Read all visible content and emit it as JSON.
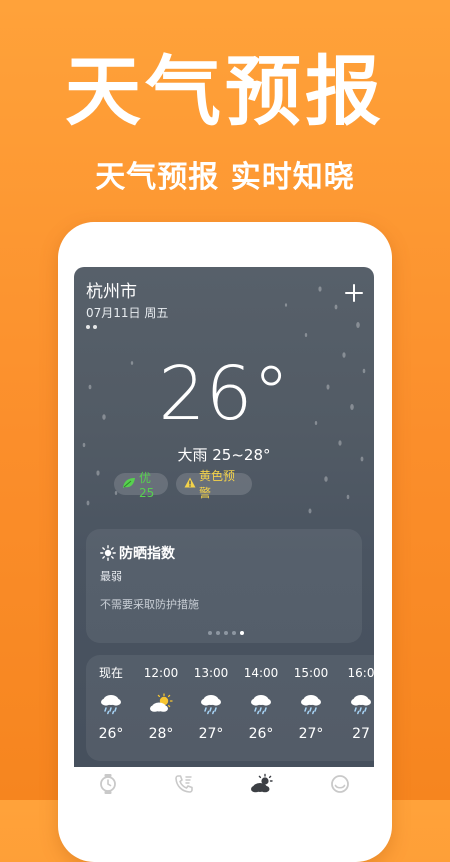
{
  "promo": {
    "title": "天气预报",
    "subtitle": "天气预报 实时知晓"
  },
  "header": {
    "city": "杭州市",
    "date": "07月11日 周五"
  },
  "current": {
    "temperature": "26°",
    "description": "大雨 25~28°"
  },
  "chips": {
    "aqi_label": "优25",
    "alert_label": "黄色预警"
  },
  "sun_index": {
    "title": "防晒指数",
    "level": "最弱",
    "tip": "不需要采取防护措施"
  },
  "hourly": [
    {
      "time": "现在",
      "icon": "heavy-rain-icon",
      "temp": "26°"
    },
    {
      "time": "12:00",
      "icon": "partly-cloudy-icon",
      "temp": "28°"
    },
    {
      "time": "13:00",
      "icon": "heavy-rain-icon",
      "temp": "27°"
    },
    {
      "time": "14:00",
      "icon": "heavy-rain-icon",
      "temp": "26°"
    },
    {
      "time": "15:00",
      "icon": "heavy-rain-icon",
      "temp": "27°"
    },
    {
      "time": "16:0",
      "icon": "heavy-rain-icon",
      "temp": "27"
    }
  ],
  "tabs": [
    {
      "name": "watch-icon"
    },
    {
      "name": "phone-icon"
    },
    {
      "name": "weather-icon",
      "active": true
    },
    {
      "name": "smile-icon"
    }
  ],
  "colors": {
    "background": "#fb8e2b",
    "aqi_green": "#57d14f",
    "alert_yellow": "#f3d24a",
    "screen_bg": "#4a5461"
  }
}
